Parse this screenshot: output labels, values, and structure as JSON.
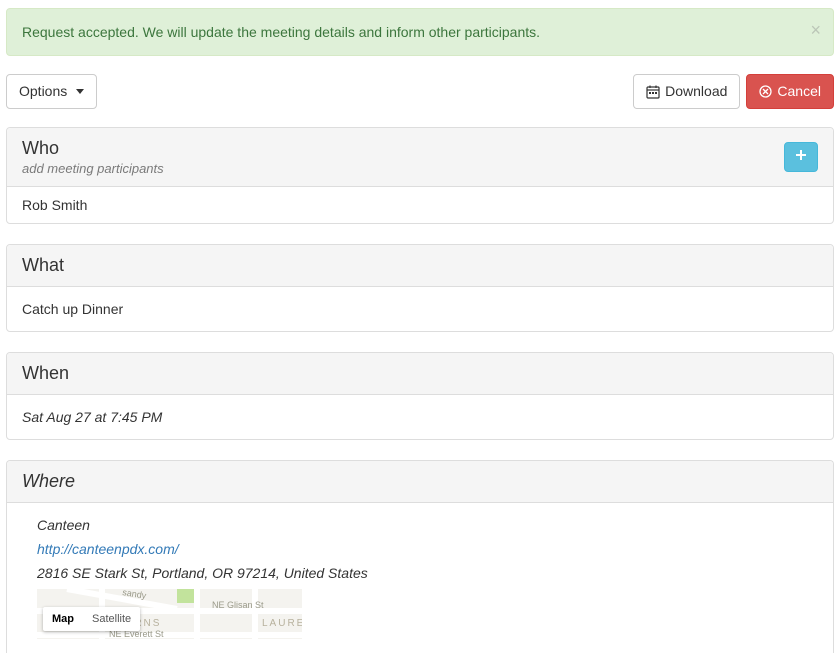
{
  "alert": {
    "message": "Request accepted. We will update the meeting details and inform other participants."
  },
  "toolbar": {
    "options_label": "Options",
    "download_label": "Download",
    "cancel_label": "Cancel"
  },
  "who": {
    "title": "Who",
    "subtitle": "add meeting participants",
    "participant": "Rob Smith"
  },
  "what": {
    "title": "What",
    "value": "Catch up Dinner"
  },
  "when": {
    "title": "When",
    "value": "Sat Aug 27 at 7:45 PM"
  },
  "where": {
    "title": "Where",
    "name": "Canteen",
    "url": "http://canteenpdx.com/",
    "address": "2816 SE Stark St, Portland, OR 97214, United States",
    "map": {
      "map_label": "Map",
      "satellite_label": "Satellite",
      "street1": "NE Glisan St",
      "street2": "NE Everett St",
      "district1": "KERNS",
      "district2": "LAUREL",
      "route": "sandy"
    }
  }
}
